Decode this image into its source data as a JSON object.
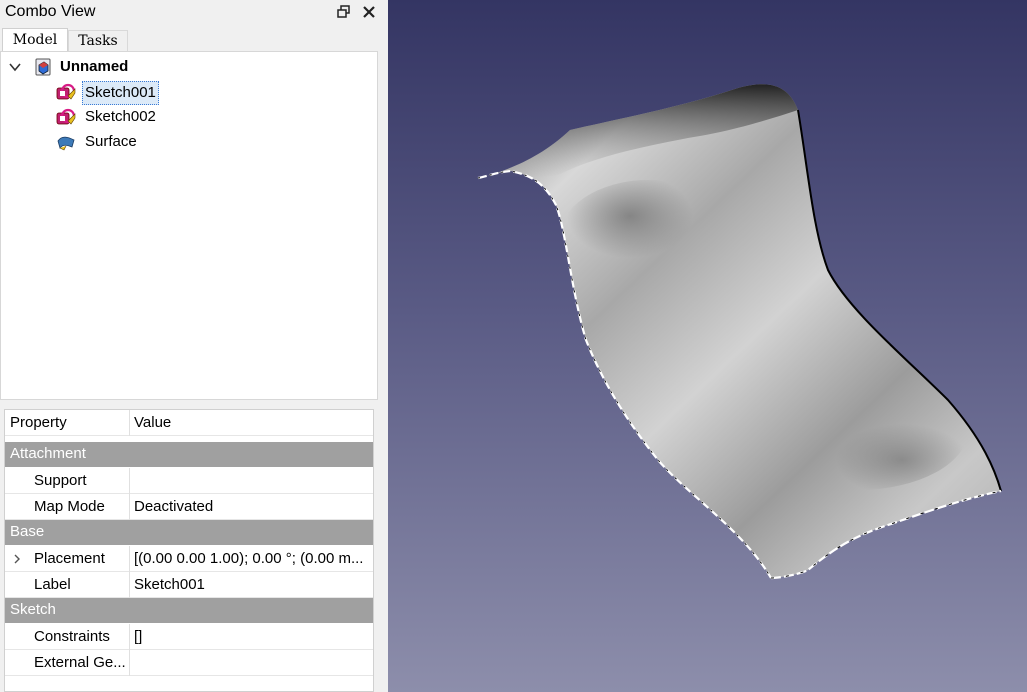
{
  "combo_view": {
    "title": "Combo View",
    "tabs": [
      {
        "label": "Model",
        "active": true
      },
      {
        "label": "Tasks",
        "active": false
      }
    ]
  },
  "tree": {
    "root": {
      "label": "Unnamed",
      "icon": "document-icon",
      "expanded": true
    },
    "items": [
      {
        "label": "Sketch001",
        "icon": "sketch-icon",
        "selected": true
      },
      {
        "label": "Sketch002",
        "icon": "sketch-icon",
        "selected": false
      },
      {
        "label": "Surface",
        "icon": "surface-icon",
        "selected": false
      }
    ]
  },
  "properties": {
    "header": {
      "property": "Property",
      "value": "Value"
    },
    "groups": [
      {
        "name": "Attachment",
        "rows": [
          {
            "name": "Support",
            "value": ""
          },
          {
            "name": "Map Mode",
            "value": "Deactivated"
          }
        ]
      },
      {
        "name": "Base",
        "rows": [
          {
            "name": "Placement",
            "value": "[(0.00 0.00 1.00); 0.00 °; (0.00 m..."
          },
          {
            "name": "Label",
            "value": "Sketch001"
          }
        ]
      },
      {
        "name": "Sketch",
        "rows": [
          {
            "name": "Constraints",
            "value": "[]"
          },
          {
            "name": "External Ge...",
            "value": ""
          }
        ]
      }
    ]
  },
  "colors": {
    "viewport_top": "#343563",
    "viewport_bottom": "#8d8eab",
    "group_header": "#a0a0a0",
    "selection": "#dceaf8"
  }
}
